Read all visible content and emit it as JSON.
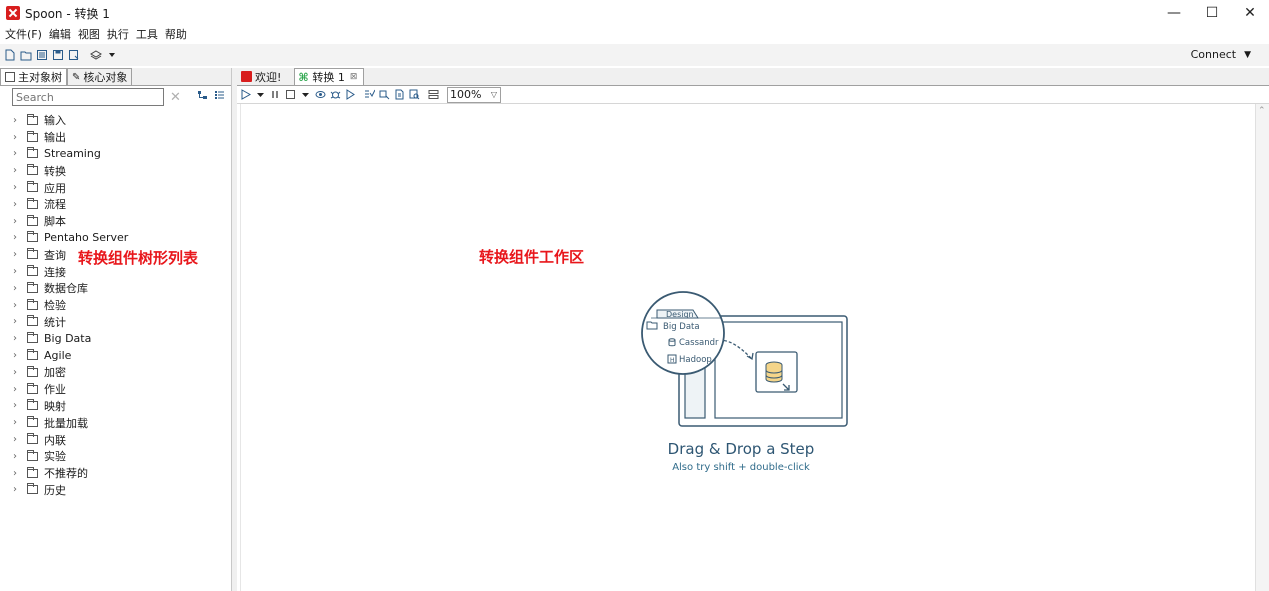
{
  "window": {
    "title": "Spoon - 转换 1",
    "minimize": "—",
    "maximize": "☐",
    "close": "✕"
  },
  "menu": {
    "items": [
      "文件(F)",
      "编辑",
      "视图",
      "执行",
      "工具",
      "帮助"
    ]
  },
  "toolbar": {
    "connect_label": "Connect",
    "connect_caret": "▼"
  },
  "left_panel": {
    "tabs": [
      "主对象树",
      "核心对象"
    ],
    "search_placeholder": "Search",
    "search_clear": "✕",
    "tree_items": [
      "输入",
      "输出",
      "Streaming",
      "转换",
      "应用",
      "流程",
      "脚本",
      "Pentaho Server",
      "查询",
      "连接",
      "数据仓库",
      "检验",
      "统计",
      "Big Data",
      "Agile",
      "加密",
      "作业",
      "映射",
      "批量加载",
      "内联",
      "实验",
      "不推荐的",
      "历史"
    ],
    "annotation": "转换组件树形列表"
  },
  "right_panel": {
    "tabs": [
      {
        "label": "欢迎!"
      },
      {
        "label": "转换 1",
        "close": "⊠"
      }
    ],
    "zoom": "100%",
    "zoom_caret": "▽",
    "annotation": "转换组件工作区",
    "illustration": {
      "design_tab": "Design",
      "big_data": "Big Data",
      "cassandra": "Cassandr",
      "hadoop": "Hadoop",
      "hadoop_badge": "H"
    },
    "drag_title": "Drag & Drop a Step",
    "drag_subtitle": "Also try shift + double-click"
  },
  "colors": {
    "accent_red": "#e8161b",
    "logo_red": "#d81e1e",
    "illustration_blue": "#3a5a72"
  }
}
